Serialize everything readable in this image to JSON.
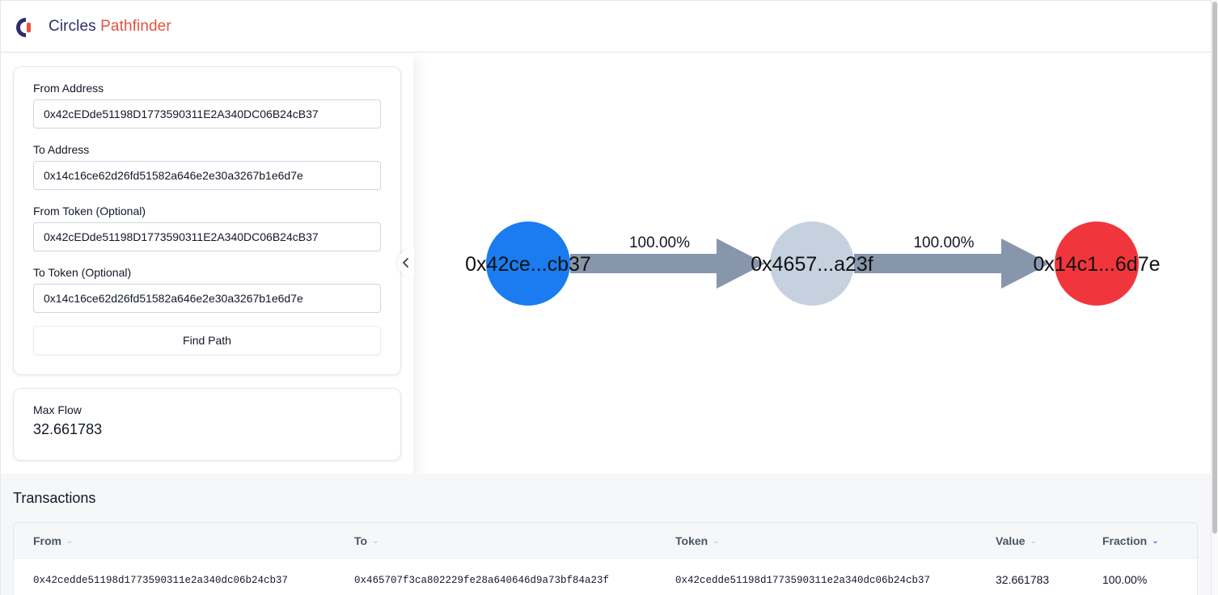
{
  "app": {
    "title_part1": "Circles",
    "title_part2": "Pathfinder",
    "colors": {
      "brand_dark": "#2b2d6e",
      "brand_accent": "#e2543e"
    }
  },
  "form": {
    "from_address": {
      "label": "From Address",
      "value": "0x42cEDde51198D1773590311E2A340DC06B24cB37"
    },
    "to_address": {
      "label": "To Address",
      "value": "0x14c16ce62d26fd51582a646e2e30a3267b1e6d7e"
    },
    "from_token": {
      "label": "From Token (Optional)",
      "value": "0x42cEDde51198D1773590311E2A340DC06B24cB37"
    },
    "to_token": {
      "label": "To Token (Optional)",
      "value": "0x14c16ce62d26fd51582a646e2e30a3267b1e6d7e"
    },
    "submit_label": "Find Path"
  },
  "max_flow": {
    "label": "Max Flow",
    "value": "32.661783"
  },
  "graph": {
    "nodes": [
      {
        "label": "0x42ce...cb37",
        "color": "#1a7cf0"
      },
      {
        "label": "0x4657...a23f",
        "color": "#c5d1de"
      },
      {
        "label": "0x14c1...6d7e",
        "color": "#f0363c"
      }
    ],
    "edges": [
      {
        "label": "100.00%",
        "color": "#8796ab"
      },
      {
        "label": "100.00%",
        "color": "#8796ab"
      }
    ]
  },
  "transactions": {
    "title": "Transactions",
    "columns": [
      "From",
      "To",
      "Token",
      "Value",
      "Fraction"
    ],
    "rows": [
      {
        "from": "0x42cedde51198d1773590311e2a340dc06b24cb37",
        "to": "0x465707f3ca802229fe28a640646d9a73bf84a23f",
        "token": "0x42cedde51198d1773590311e2a340dc06b24cb37",
        "value": "32.661783",
        "fraction": "100.00%"
      }
    ]
  }
}
